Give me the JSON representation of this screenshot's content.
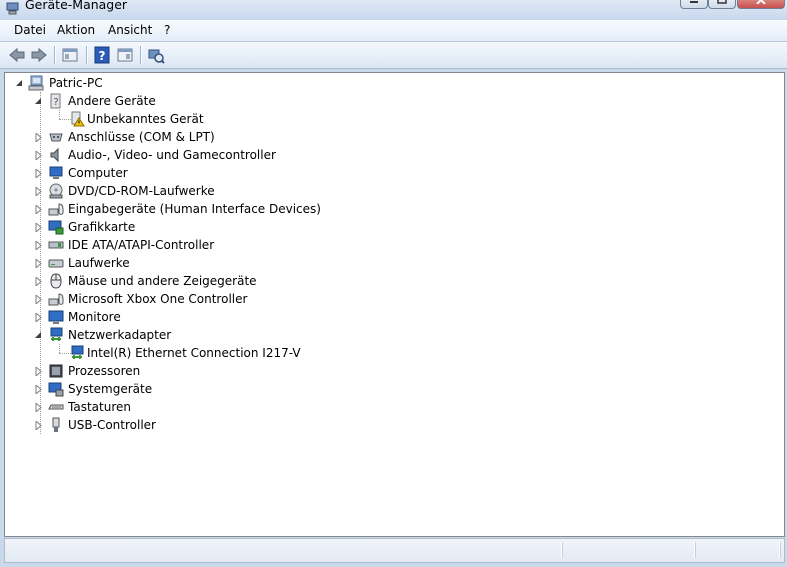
{
  "window": {
    "title": "Geräte-Manager"
  },
  "menu": [
    "Datei",
    "Aktion",
    "Ansicht",
    "?"
  ],
  "toolbar": {
    "buttons": [
      "back-arrow-icon",
      "forward-arrow-icon",
      "properties-icon",
      "help-icon",
      "view-icon",
      "scan-hardware-icon"
    ]
  },
  "tree": {
    "root": "Patric-PC",
    "categories": [
      {
        "label": "Andere Geräte",
        "expanded": true,
        "children": [
          "Unbekanntes Gerät"
        ]
      },
      {
        "label": "Anschlüsse (COM & LPT)"
      },
      {
        "label": "Audio-, Video- und Gamecontroller"
      },
      {
        "label": "Computer"
      },
      {
        "label": "DVD/CD-ROM-Laufwerke"
      },
      {
        "label": "Eingabegeräte (Human Interface Devices)"
      },
      {
        "label": "Grafikkarte"
      },
      {
        "label": "IDE ATA/ATAPI-Controller"
      },
      {
        "label": "Laufwerke"
      },
      {
        "label": "Mäuse und andere Zeigegeräte"
      },
      {
        "label": "Microsoft Xbox One Controller"
      },
      {
        "label": "Monitore"
      },
      {
        "label": "Netzwerkadapter",
        "expanded": true,
        "children": [
          "Intel(R) Ethernet Connection I217-V"
        ]
      },
      {
        "label": "Prozessoren"
      },
      {
        "label": "Systemgeräte"
      },
      {
        "label": "Tastaturen"
      },
      {
        "label": "USB-Controller"
      }
    ]
  },
  "colors": {
    "window_frame": "#c9d9ec",
    "warning": "#f5c400",
    "tree_line": "#a0a0a0"
  }
}
